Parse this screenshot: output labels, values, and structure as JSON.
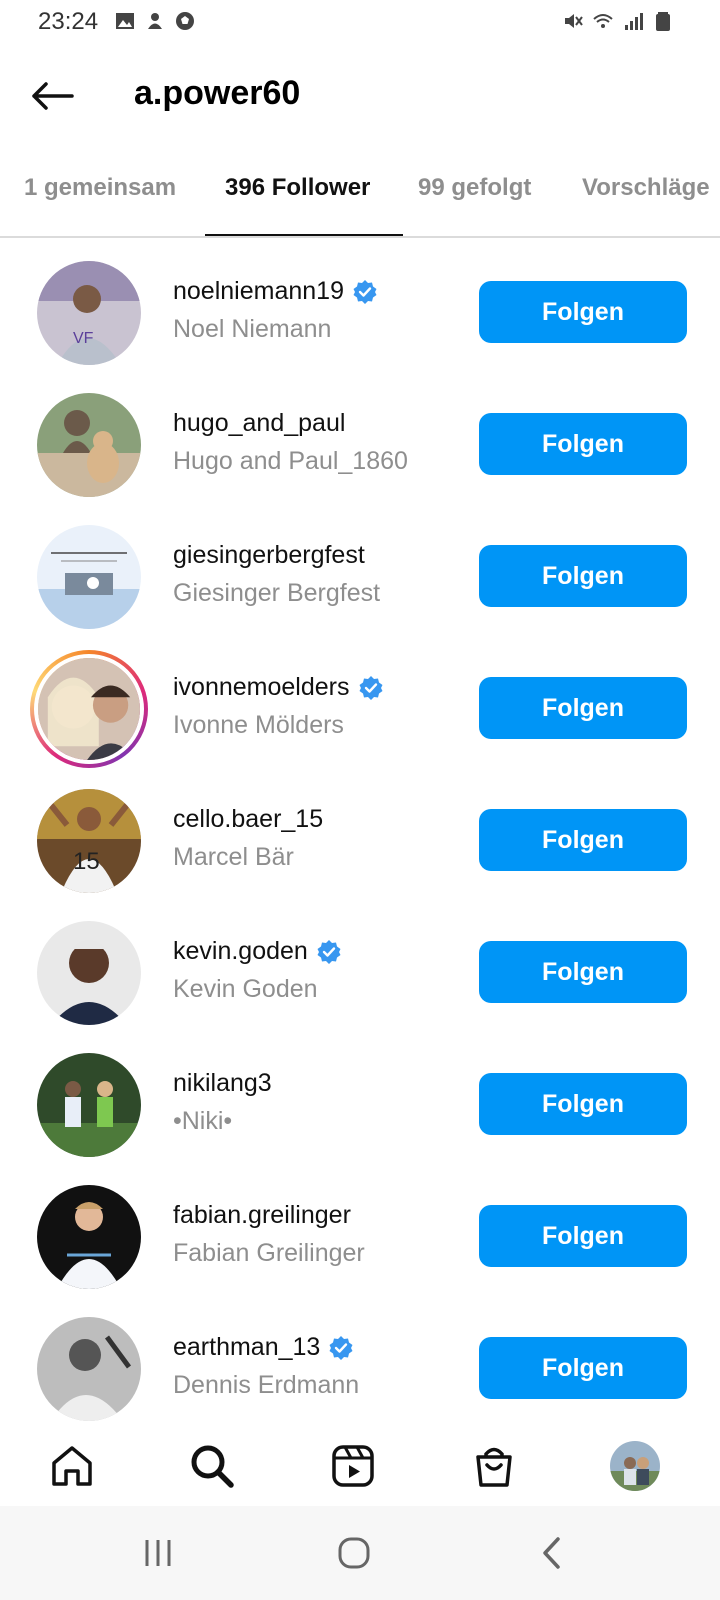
{
  "status_bar": {
    "time": "23:24",
    "left_icons": [
      "gallery-icon",
      "app-notification-icon",
      "soccer-ball-icon"
    ],
    "right_icons": [
      "mute-icon",
      "wifi-icon",
      "signal-icon",
      "battery-icon"
    ]
  },
  "header": {
    "title": "a.power60",
    "back_icon": "arrow-left-icon"
  },
  "tabs": [
    {
      "label": "1 gemeinsam",
      "active": false
    },
    {
      "label": "396 Follower",
      "active": true
    },
    {
      "label": "99 gefolgt",
      "active": false
    },
    {
      "label": "Vorschläge",
      "active": false
    }
  ],
  "followers": [
    {
      "handle": "noelniemann19",
      "name": "Noel Niemann",
      "verified": true,
      "story": false,
      "button": "Folgen"
    },
    {
      "handle": "hugo_and_paul",
      "name": "Hugo and Paul_1860",
      "verified": false,
      "story": false,
      "button": "Folgen"
    },
    {
      "handle": "giesingerbergfest",
      "name": "Giesinger Bergfest",
      "verified": false,
      "story": false,
      "button": "Folgen"
    },
    {
      "handle": "ivonnemoelders",
      "name": "Ivonne Mölders",
      "verified": true,
      "story": true,
      "button": "Folgen"
    },
    {
      "handle": "cello.baer_15",
      "name": "Marcel Bär",
      "verified": false,
      "story": false,
      "button": "Folgen"
    },
    {
      "handle": "kevin.goden",
      "name": "Kevin Goden",
      "verified": true,
      "story": false,
      "button": "Folgen"
    },
    {
      "handle": "nikilang3",
      "name": "•Niki•",
      "verified": false,
      "story": false,
      "button": "Folgen"
    },
    {
      "handle": "fabian.greilinger",
      "name": "Fabian Greilinger",
      "verified": false,
      "story": false,
      "button": "Folgen"
    },
    {
      "handle": "earthman_13",
      "name": "Dennis Erdmann",
      "verified": true,
      "story": false,
      "button": "Folgen"
    }
  ],
  "bottom_nav": [
    "home-icon",
    "search-icon",
    "reels-icon",
    "shop-icon",
    "profile-avatar"
  ],
  "system_nav": [
    "recent-apps-icon",
    "home-circle-icon",
    "back-chevron-icon"
  ],
  "colors": {
    "button": "#0095f6",
    "verified": "#3897f0",
    "muted_text": "#8e8e8e"
  }
}
